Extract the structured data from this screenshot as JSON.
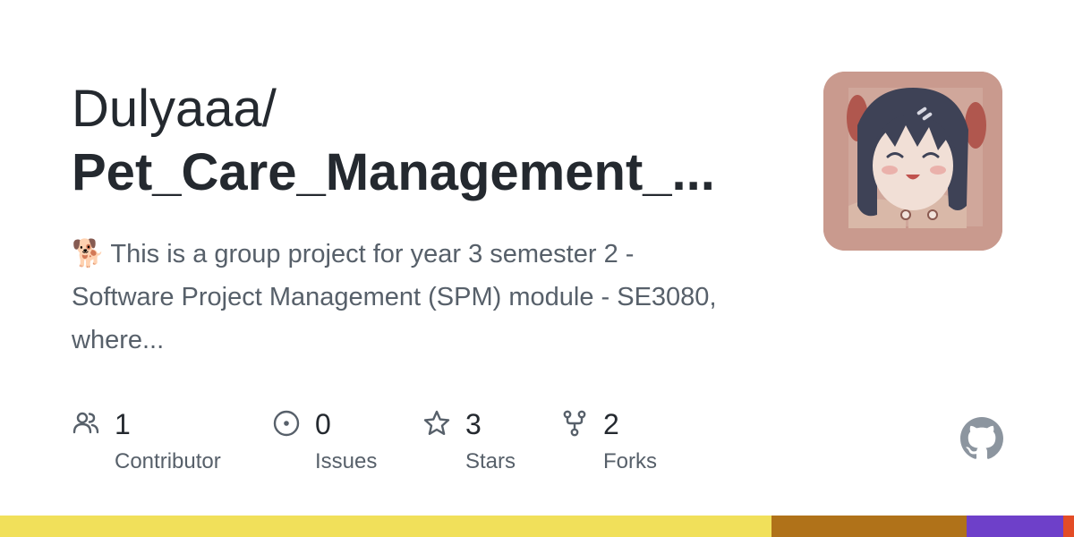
{
  "repo": {
    "owner": "Dulyaaa/",
    "name": "Pet_Care_Management_...",
    "emoji": "🐕",
    "description": "This is a group project for year 3 semester 2 - Software Project Management (SPM) module - SE3080, where..."
  },
  "stats": [
    {
      "icon": "people-icon",
      "value": "1",
      "label": "Contributor"
    },
    {
      "icon": "issue-icon",
      "value": "0",
      "label": "Issues"
    },
    {
      "icon": "star-icon",
      "value": "3",
      "label": "Stars"
    },
    {
      "icon": "fork-icon",
      "value": "2",
      "label": "Forks"
    }
  ],
  "icons": {
    "brand": "github-logo-icon"
  },
  "language_bar": [
    {
      "color": "#f1e05a",
      "share": 0.718
    },
    {
      "color": "#b07219",
      "share": 0.182
    },
    {
      "color": "#6e40c9",
      "share": 0.09
    },
    {
      "color": "#e34c26",
      "share": 0.01
    }
  ],
  "colors": {
    "text": "#24292f",
    "muted": "#57606a"
  }
}
